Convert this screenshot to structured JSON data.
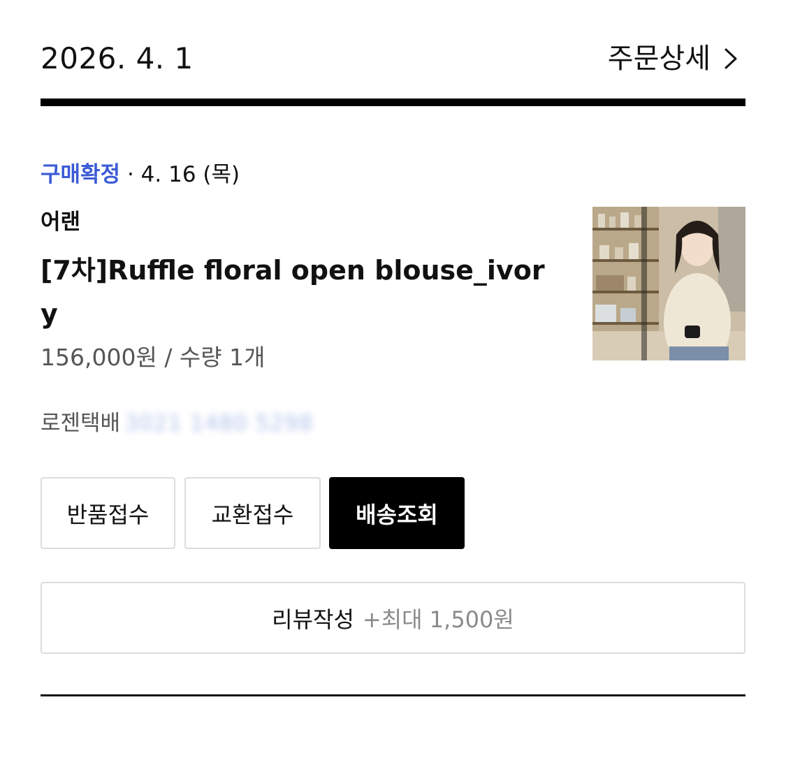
{
  "order": {
    "date": "2026. 4. 1",
    "detail_link": "주문상세"
  },
  "item": {
    "status": "구매확정",
    "status_separator": "·",
    "status_date": "4. 16 (목)",
    "brand": "어랜",
    "name": "[7차]Ruffle floral open blouse_ivory",
    "price_qty": "156,000원 / 수량 1개",
    "courier": "로젠택배",
    "tracking_number": "3021 1480 5298"
  },
  "actions": {
    "return": "반품접수",
    "exchange": "교환접수",
    "tracking": "배송조회"
  },
  "review": {
    "label": "리뷰작성",
    "reward": "+최대 1,500원"
  },
  "colors": {
    "status_accent": "#3b5bd6",
    "primary_button": "#000000",
    "border": "#dcdcdc"
  },
  "icons": {
    "detail_chevron": "chevron-right-icon"
  }
}
